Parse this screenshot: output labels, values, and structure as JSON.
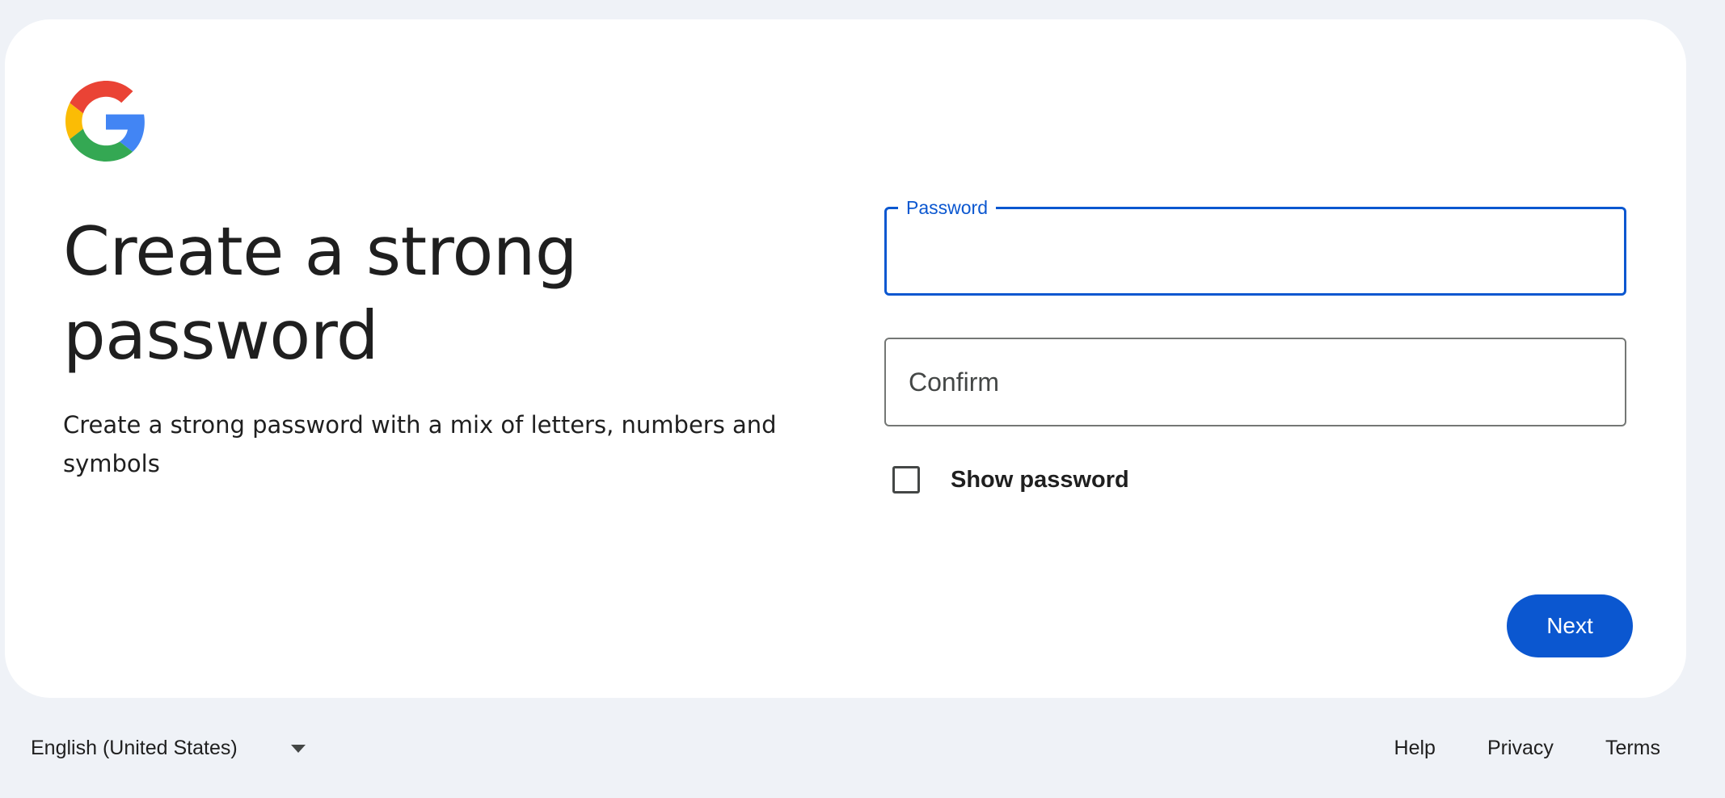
{
  "logo": {
    "icon": "google-g-logo-icon",
    "colors": [
      "#ea4335",
      "#fbbc05",
      "#34a853",
      "#4285f4"
    ]
  },
  "main": {
    "title": "Create a strong password",
    "subtitle": "Create a strong password with a mix of letters, numbers and symbols"
  },
  "form": {
    "password_label": "Password",
    "password_value": "",
    "confirm_placeholder": "Confirm",
    "confirm_value": "",
    "show_password_label": "Show password",
    "show_password_checked": false,
    "next_label": "Next"
  },
  "footer": {
    "language": "English (United States)",
    "links": [
      "Help",
      "Privacy",
      "Terms"
    ]
  },
  "colors": {
    "accent": "#0b57d0",
    "page_background": "#eff2f7",
    "card_background": "#ffffff"
  }
}
